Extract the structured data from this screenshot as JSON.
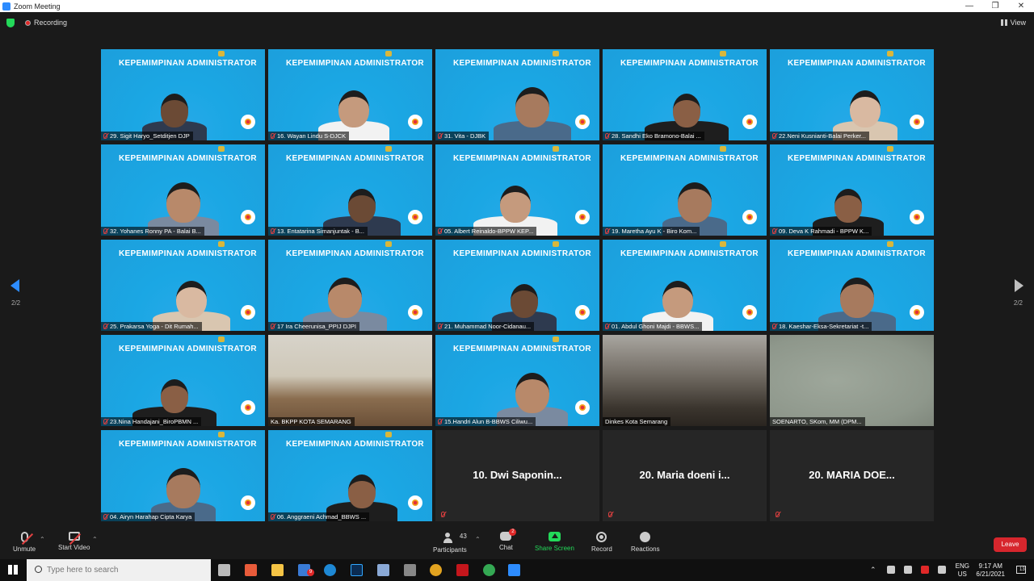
{
  "window": {
    "title": "Zoom Meeting"
  },
  "topbar": {
    "recording_label": "Recording",
    "view_label": "View"
  },
  "gallery": {
    "page_indicator": "2/2",
    "banner": "KEPEMIMPINAN ADMINISTRATOR",
    "tiles": [
      {
        "name": "29. Sigit Haryo_Setditjen DJP",
        "type": "blue"
      },
      {
        "name": "16. Wayan Lindu S-DJCK",
        "type": "blue"
      },
      {
        "name": "31. Vita - DJBK",
        "type": "blue"
      },
      {
        "name": "28. Sandhi Eko Bramono-Balai ...",
        "type": "blue"
      },
      {
        "name": "22.Neni Kusnianti-Balai Perker...",
        "type": "blue"
      },
      {
        "name": "32. Yohanes Ronny PA - Balai B...",
        "type": "blue"
      },
      {
        "name": "13. Entatarina Simanjuntak - B...",
        "type": "blue"
      },
      {
        "name": "05. Albert Reinaldo-BPPW KEP...",
        "type": "blue"
      },
      {
        "name": "19. Maretha Ayu K - Biro Kom...",
        "type": "blue"
      },
      {
        "name": "09. Deva K Rahmadi - BPPW K...",
        "type": "blue"
      },
      {
        "name": "25. Prakarsa Yoga - Dit Rumah...",
        "type": "blue"
      },
      {
        "name": "17 Ira Cheerunisa_PPIJ DJPI",
        "type": "blue"
      },
      {
        "name": "21. Muhammad Noor-Cidanau...",
        "type": "blue"
      },
      {
        "name": "01. Abdul Ghoni Majdi - BBWS...",
        "type": "blue"
      },
      {
        "name": "18. Kaeshar-Eksa-Sekretariat -t...",
        "type": "blue"
      },
      {
        "name": "23.Nina Handajani_BiroPBMN ...",
        "type": "blue"
      },
      {
        "name": "Ka. BKPP KOTA SEMARANG",
        "type": "office"
      },
      {
        "name": "15.Handri Alun B-BBWS Ciliwu...",
        "type": "blue"
      },
      {
        "name": "Dinkes Kota Semarang",
        "type": "city"
      },
      {
        "name": "SOENARTO, SKom, MM (DPM...",
        "type": "gray"
      },
      {
        "name": "04. Airyn Harahap Cipta Karya",
        "type": "blue"
      },
      {
        "name": "06. Anggraeni Achmad_BBWS ...",
        "type": "blue"
      },
      {
        "name": "10. Dwi Saponin...",
        "type": "dark"
      },
      {
        "name": "20. Maria doeni i...",
        "type": "dark"
      },
      {
        "name": "20. MARIA DOE...",
        "type": "dark"
      }
    ]
  },
  "controls": {
    "unmute": "Unmute",
    "start_video": "Start Video",
    "participants": "Participants",
    "participants_count": "43",
    "chat": "Chat",
    "chat_badge": "2",
    "share_screen": "Share Screen",
    "record": "Record",
    "reactions": "Reactions",
    "leave": "Leave"
  },
  "taskbar": {
    "search_placeholder": "Type here to search",
    "mail_badge": "9",
    "lang_top": "ENG",
    "lang_bottom": "US",
    "time": "9:17 AM",
    "date": "6/21/2021",
    "notif_count": "13"
  },
  "colors": {
    "zoom_blue": "#2d8cff",
    "share_green": "#23d959",
    "leave_red": "#d7262d",
    "tile_blue": "#1ba7e4"
  }
}
